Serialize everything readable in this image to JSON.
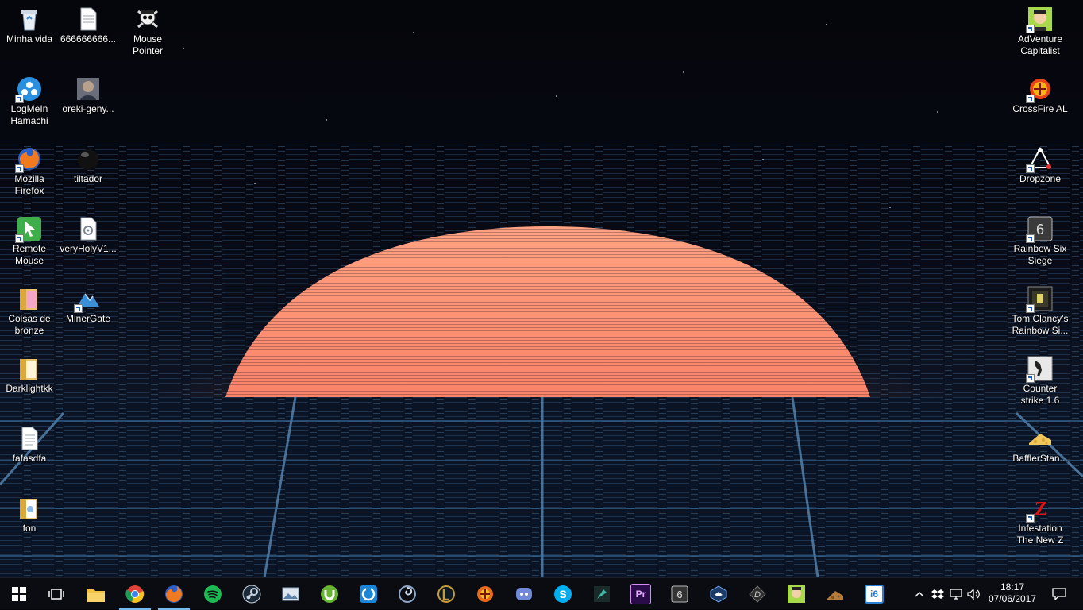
{
  "desktop": {
    "left_column": [
      {
        "label": "Minha vida",
        "icon": "recycle-bin-icon"
      },
      {
        "label": "LogMeIn Hamachi",
        "icon": "hamachi-icon"
      },
      {
        "label": "Mozilla Firefox",
        "icon": "firefox-icon"
      },
      {
        "label": "Remote Mouse",
        "icon": "remote-mouse-icon"
      },
      {
        "label": "Coisas de bronze",
        "icon": "folder-icon"
      },
      {
        "label": "Darklightkk",
        "icon": "folder-icon"
      },
      {
        "label": "fafasdfa",
        "icon": "text-file-icon"
      },
      {
        "label": "fon",
        "icon": "folder-icon"
      }
    ],
    "second_column": [
      {
        "label": "666666666...",
        "icon": "text-file-icon"
      },
      {
        "label": "oreki-geny...",
        "icon": "image-file-icon"
      },
      {
        "label": "tiltador",
        "icon": "black-orb-icon"
      },
      {
        "label": "veryHolyV1...",
        "icon": "settings-file-icon"
      },
      {
        "label": "MinerGate",
        "icon": "minergate-icon"
      }
    ],
    "third_column": [
      {
        "label": "Mouse Pointer",
        "icon": "skull-icon"
      }
    ],
    "right_column": [
      {
        "label": "AdVenture Capitalist",
        "icon": "adventure-capitalist-icon"
      },
      {
        "label": "CrossFire AL",
        "icon": "crossfire-icon"
      },
      {
        "label": "Dropzone",
        "icon": "dropzone-icon"
      },
      {
        "label": "Rainbow Six Siege",
        "icon": "rainbow-six-icon"
      },
      {
        "label": "Tom Clancy's Rainbow Si...",
        "icon": "tom-clancy-icon"
      },
      {
        "label": "Counter strike 1.6",
        "icon": "counter-strike-icon"
      },
      {
        "label": "BafflerStan...",
        "icon": "cheese-icon"
      },
      {
        "label": "Infestation The New Z",
        "icon": "infestation-icon"
      }
    ]
  },
  "taskbar": {
    "pinned": [
      {
        "name": "file-explorer",
        "color": "#f3c242"
      },
      {
        "name": "chrome",
        "color": "#de4437"
      },
      {
        "name": "firefox",
        "color": "#e8662a"
      },
      {
        "name": "spotify",
        "color": "#1db954"
      },
      {
        "name": "steam",
        "color": "#1b2838"
      },
      {
        "name": "photos",
        "color": "#8fa2b7"
      },
      {
        "name": "utorrent",
        "color": "#67b531"
      },
      {
        "name": "uplay",
        "color": "#1b86d6"
      },
      {
        "name": "origin-swirl",
        "color": "#5a6c86"
      },
      {
        "name": "league-of-legends",
        "color": "#c89b3c"
      },
      {
        "name": "crossfire",
        "color": "#e86b1c"
      },
      {
        "name": "discord",
        "color": "#7289da"
      },
      {
        "name": "skype",
        "color": "#00aff0"
      },
      {
        "name": "unknown-app",
        "color": "#2e6f6a"
      },
      {
        "name": "premiere-pro",
        "color": "#2a0c4a"
      },
      {
        "name": "rainbow-six",
        "color": "#333333"
      },
      {
        "name": "rocket-league",
        "color": "#3a79c8"
      },
      {
        "name": "dropzone",
        "color": "#3a3a3a"
      },
      {
        "name": "adventure-capitalist",
        "color": "#9ac33a"
      },
      {
        "name": "bafflerstan",
        "color": "#8a5a2e"
      },
      {
        "name": "i6",
        "color": "#2a7fd0"
      }
    ],
    "pinned_labels": {
      "premiere": "Pr",
      "i6": "i6"
    },
    "clock": {
      "time": "18:17",
      "date": "07/06/2017"
    }
  }
}
